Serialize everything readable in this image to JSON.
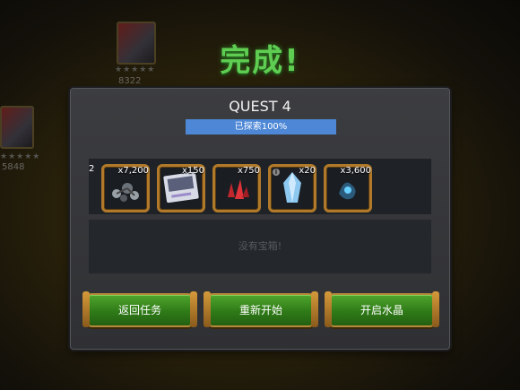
{
  "screen_title": "完成!",
  "quest_name": "QUEST 4",
  "exploration": {
    "label": "已探索100%",
    "percent": 100
  },
  "background": {
    "champion_rating_1": "8322",
    "champion_rating_2": "5848",
    "stars": "★★★★★"
  },
  "rewards": [
    {
      "icon": "iso8-cluster-icon",
      "qty": "x7,200"
    },
    {
      "icon": "upgrade-card-icon",
      "qty": "x150"
    },
    {
      "icon": "red-shards-icon",
      "qty": "x750"
    },
    {
      "icon": "blue-crystal-icon",
      "qty": "x20",
      "info": "i"
    },
    {
      "icon": "catalyst-fragment-icon",
      "qty": "x3,600"
    }
  ],
  "partial_item": "2",
  "chest_text": "没有宝箱!",
  "buttons": {
    "back": "返回任务",
    "restart": "重新开始",
    "open_crystal": "开启水晶"
  },
  "colors": {
    "title_green": "#5fcd52",
    "progress_blue": "#4d87d6",
    "button_green": "#2f7a18",
    "frame_gold": "#b07a2a"
  }
}
